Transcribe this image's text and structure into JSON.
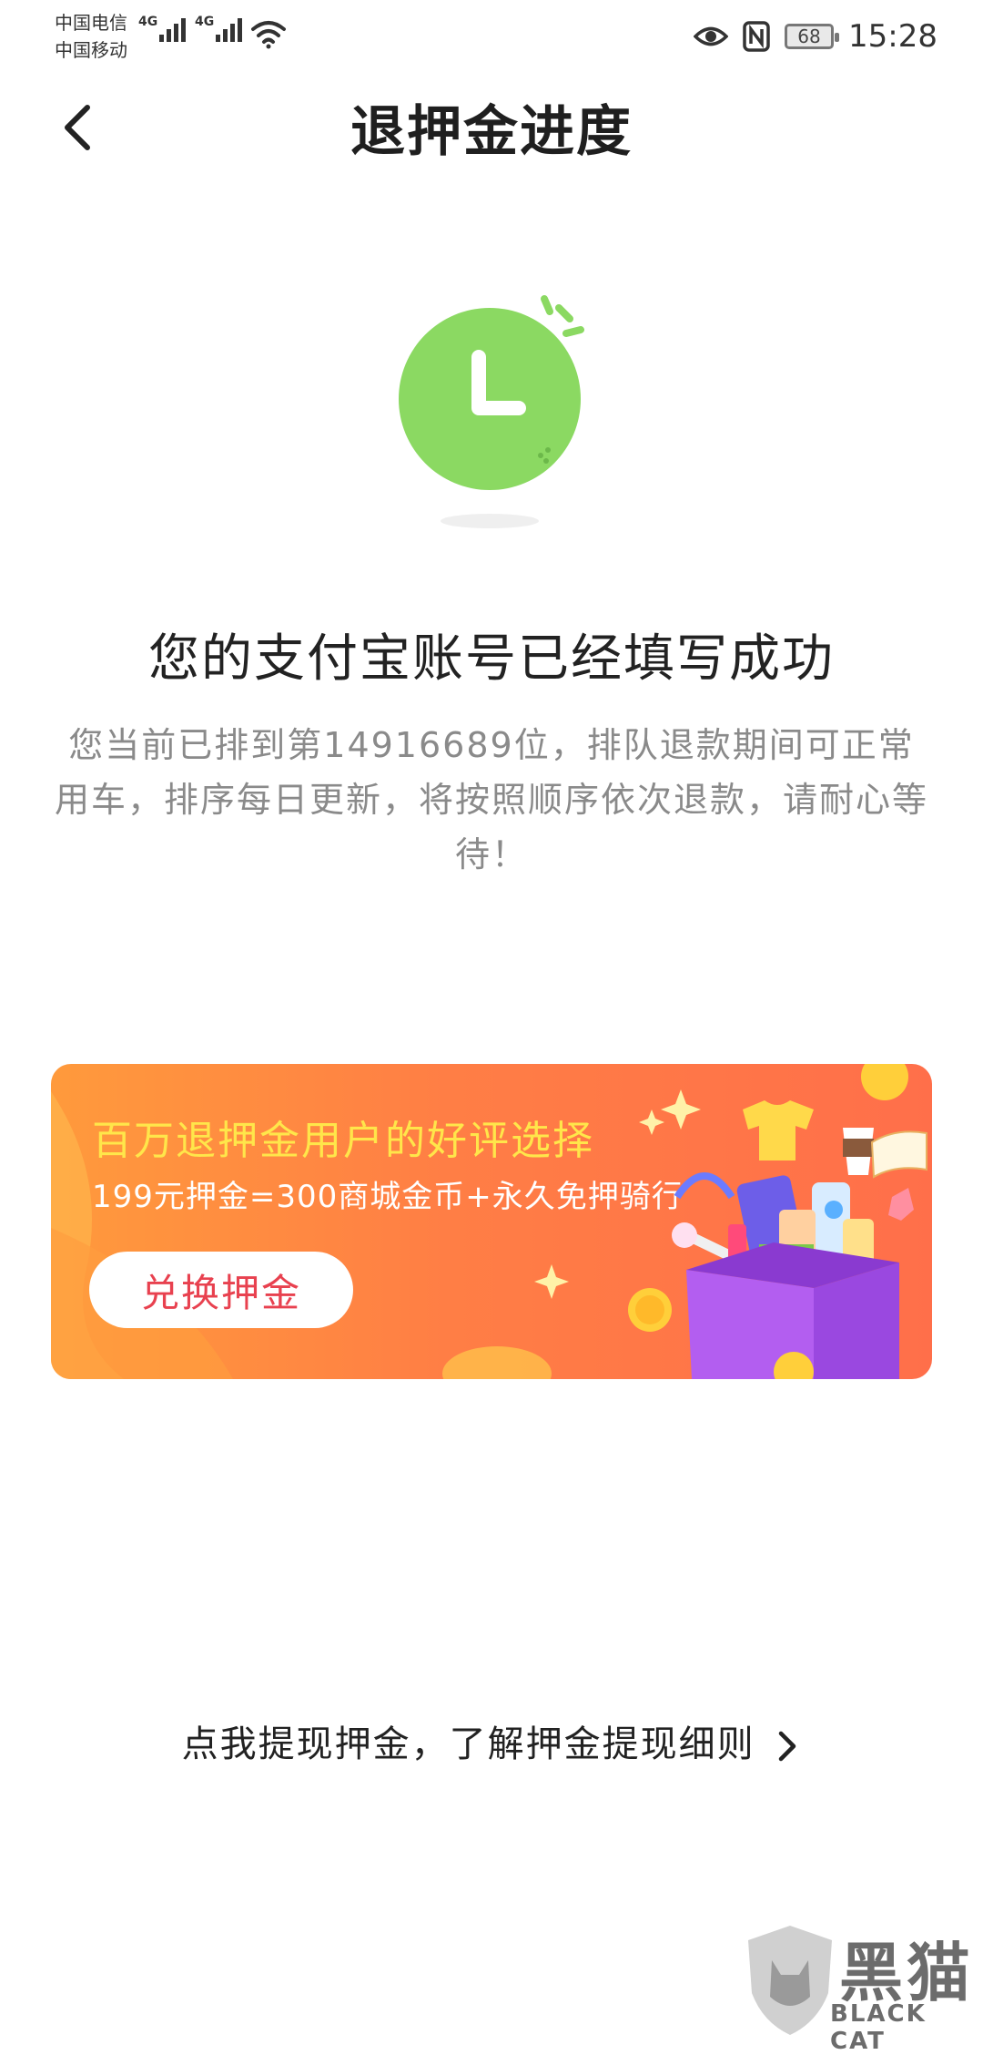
{
  "status_bar": {
    "carrier_1": "中国电信",
    "carrier_2": "中国移动",
    "network_1": "4G",
    "network_2": "4G",
    "battery": "68",
    "time": "15:28",
    "icons": [
      "signal-icon",
      "wifi-icon",
      "eye-icon",
      "nfc-icon",
      "battery-icon"
    ]
  },
  "header": {
    "title": "退押金进度",
    "back_icon": "back-arrow-icon"
  },
  "status": {
    "icon": "clock-icon",
    "headline": "您的支付宝账号已经填写成功",
    "description": "您当前已排到第14916689位，排队退款期间可正常用车，排序每日更新，将按照顺序依次退款，请耐心等待！"
  },
  "banner": {
    "title": "百万退押金用户的好评选择",
    "subtitle": "199元押金=300商城金币+永久免押骑行",
    "button_label": "兑换押金",
    "colors": {
      "background": "#ff7e45",
      "title": "#ffe64a",
      "button_text": "#e8414f"
    }
  },
  "footer": {
    "link_text": "点我提现押金，了解押金提现细则"
  },
  "watermark": {
    "text": "黑猫",
    "sub": "BLACK CAT"
  },
  "accent_color": "#8bd962"
}
